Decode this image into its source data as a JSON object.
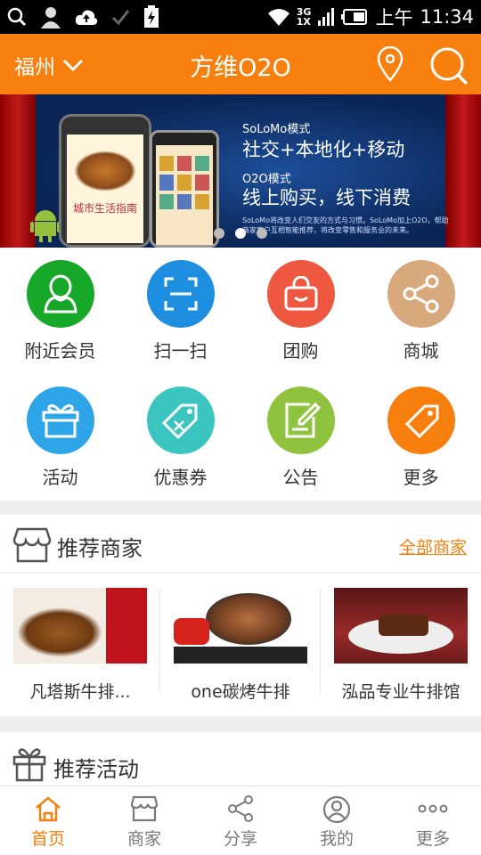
{
  "status": {
    "time_prefix": "上午",
    "time": "11:34",
    "net_top": "3G",
    "net_bottom": "1X"
  },
  "header": {
    "city": "福州",
    "title": "方维O2O"
  },
  "banner": {
    "line1": "SoLoMo模式",
    "line2": "社交+本地化+移动",
    "line3": "O2O模式",
    "line4": "线上购买，线下消费",
    "line5": "SoLoMo将改变人们交友的方式与习惯。SoLoMo加上O2O，帮助商家客户互相智能推荐，将改变零售和服务业的未来。",
    "phone_caption": "城市生活指南",
    "active_slide": 1,
    "slide_count": 3
  },
  "menu": [
    {
      "label": "附近会员",
      "icon": "person-icon",
      "color": "#17a829"
    },
    {
      "label": "扫一扫",
      "icon": "scan-icon",
      "color": "#1e8fe0"
    },
    {
      "label": "团购",
      "icon": "shopping-bag-icon",
      "color": "#ef5840"
    },
    {
      "label": "商城",
      "icon": "share-icon",
      "color": "#d7a97c"
    },
    {
      "label": "活动",
      "icon": "gift-icon",
      "color": "#2ea5e8"
    },
    {
      "label": "优惠券",
      "icon": "coupon-icon",
      "color": "#3cc5c0"
    },
    {
      "label": "公告",
      "icon": "notice-icon",
      "color": "#8fc23d"
    },
    {
      "label": "更多",
      "icon": "tag-icon",
      "color": "#f77f0d"
    }
  ],
  "recommended_shops": {
    "title": "推荐商家",
    "more": "全部商家",
    "items": [
      {
        "name": "凡塔斯牛排..."
      },
      {
        "name": "one碳烤牛排"
      },
      {
        "name": "泓品专业牛排馆"
      }
    ]
  },
  "recommended_events": {
    "title": "推荐活动"
  },
  "tabs": [
    {
      "label": "首页",
      "icon": "home-icon",
      "active": true
    },
    {
      "label": "商家",
      "icon": "store-icon",
      "active": false
    },
    {
      "label": "分享",
      "icon": "share-icon",
      "active": false
    },
    {
      "label": "我的",
      "icon": "user-icon",
      "active": false
    },
    {
      "label": "更多",
      "icon": "more-dots-icon",
      "active": false
    }
  ],
  "colors": {
    "brand": "#f77f0d",
    "status_bar": "#000000",
    "background": "#eeeeee"
  }
}
